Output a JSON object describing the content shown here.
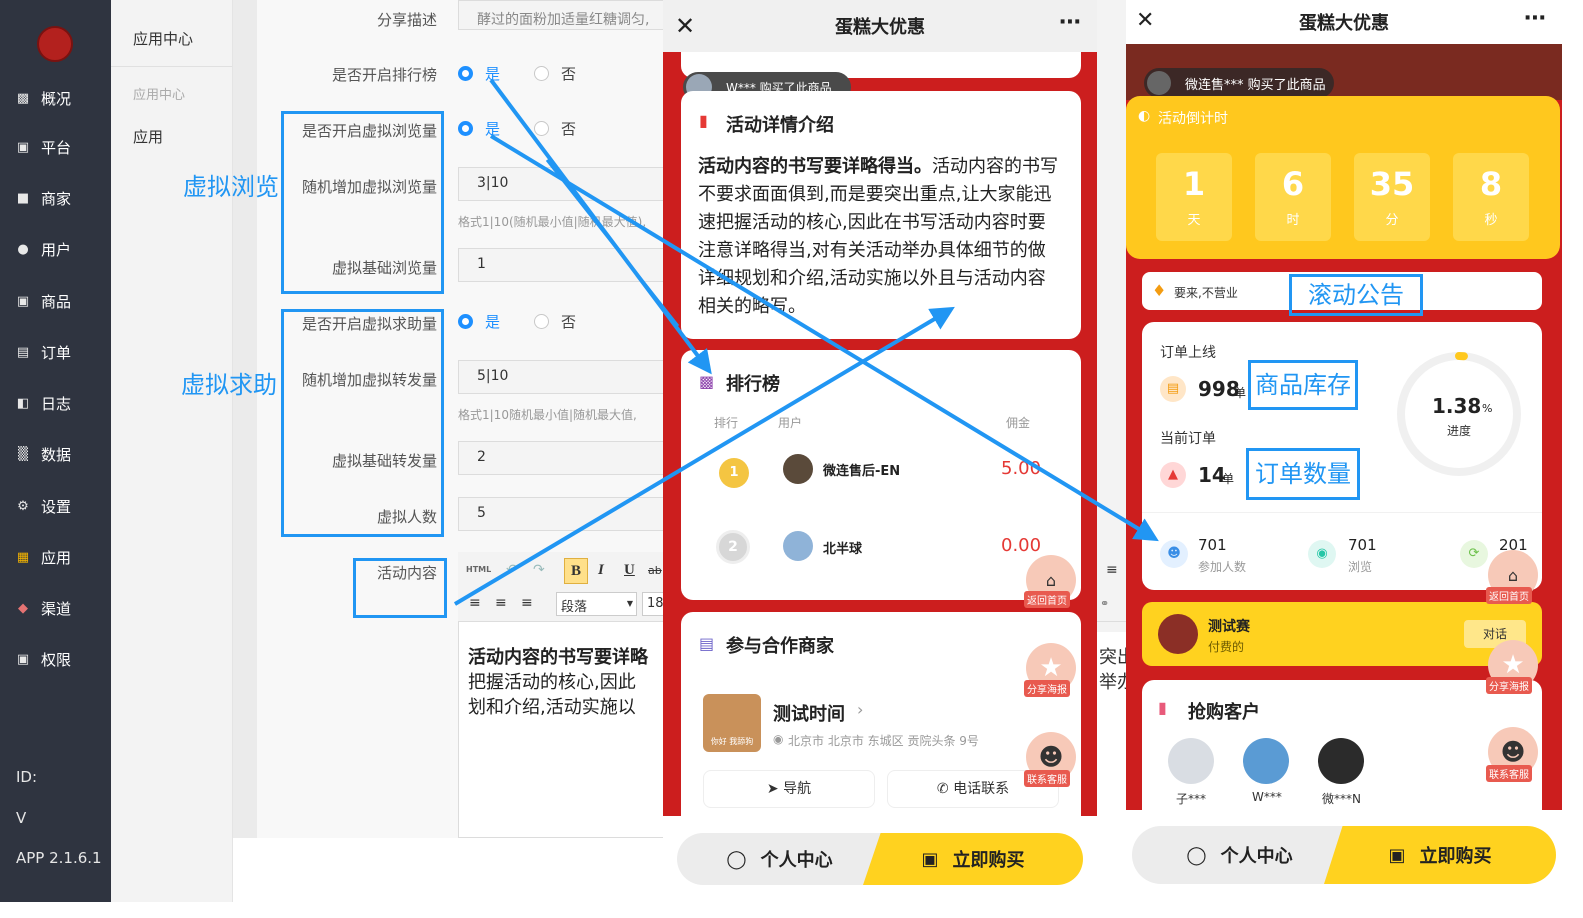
{
  "sidebar": {
    "items": [
      {
        "label": "概况",
        "icon": "chart-icon"
      },
      {
        "label": "平台",
        "icon": "monitor-icon"
      },
      {
        "label": "商家",
        "icon": "store-icon"
      },
      {
        "label": "用户",
        "icon": "user-icon"
      },
      {
        "label": "商品",
        "icon": "goods-icon"
      },
      {
        "label": "订单",
        "icon": "order-icon"
      },
      {
        "label": "日志",
        "icon": "log-icon"
      },
      {
        "label": "数据",
        "icon": "data-icon"
      },
      {
        "label": "设置",
        "icon": "gear-icon"
      },
      {
        "label": "应用",
        "icon": "apps-icon"
      },
      {
        "label": "渠道",
        "icon": "channel-icon"
      },
      {
        "label": "权限",
        "icon": "lock-icon"
      }
    ],
    "footer": {
      "id": "ID:",
      "v": "V",
      "app": "APP 2.1.6.1"
    }
  },
  "submenu": {
    "title": "应用中心",
    "section": "应用中心",
    "item": "应用"
  },
  "form": {
    "share_desc_label": "分享描述",
    "share_desc_value": "酵过的面粉加适量红糖调匀,",
    "rank_label": "是否开启排行榜",
    "virtual_view_label": "是否开启虚拟浏览量",
    "rand_view_label": "随机增加虚拟浏览量",
    "rand_view_value": "3|10",
    "rand_view_hint": "格式1|10(随机最小值|随机最大值),",
    "base_view_label": "虚拟基础浏览量",
    "base_view_value": "1",
    "virtual_help_label": "是否开启虚拟求助量",
    "rand_share_label": "随机增加虚拟转发量",
    "rand_share_value": "5|10",
    "rand_share_hint": "格式1|10随机最小值|随机最大值,",
    "base_share_label": "虚拟基础转发量",
    "base_share_value": "2",
    "virtual_people_label": "虚拟人数",
    "virtual_people_value": "5",
    "content_label": "活动内容",
    "yes": "是",
    "no": "否",
    "editor_html": "HTML",
    "editor_para": "段落",
    "editor_size": "18",
    "editor_text_bold": "活动内容的书写要详略",
    "editor_text_2": "把握活动的核心,因此",
    "editor_text_3": "划和介绍,活动实施以",
    "editor_overflow_1": "突出",
    "editor_overflow_2": "举办"
  },
  "callouts": {
    "virtual_view": "虚拟浏览",
    "virtual_help": "虚拟求助",
    "scroll_notice": "滚动公告",
    "stock": "商品库存",
    "orders": "订单数量"
  },
  "phone1": {
    "title": "蛋糕大优惠",
    "purchase_toast": "W*** 购买了此商品",
    "detail_title": "活动详情介绍",
    "detail_bold": "活动内容的书写要详略得当。",
    "detail_text": "活动内容的书写不要求面面俱到,而是要突出重点,让大家能迅速把握活动的核心,因此在书写活动内容时要注意详略得当,对有关活动举办具体细节的做详细规划和介绍,活动实施以外且与活动内容相关的略写。",
    "rank_title": "排行榜",
    "rank_cols": [
      "排行",
      "用户",
      "佣金"
    ],
    "rank_rows": [
      {
        "badge": "1",
        "user": "微连售后-EN",
        "amount": "5.00"
      },
      {
        "badge": "2",
        "user": "北半球",
        "amount": "0.00"
      }
    ],
    "merchant_title": "参与合作商家",
    "merchant_name": "测试时间",
    "merchant_addr": "北京市 北京市 东城区 贡院头条 9号",
    "merchant_thumb_text": "你好 我舔狗",
    "nav_btn": "导航",
    "call_btn": "电话联系",
    "float_home": "返回首页",
    "float_share": "分享海报",
    "float_service": "联系客服",
    "btn_personal": "个人中心",
    "btn_buy": "立即购买"
  },
  "phone2": {
    "title": "蛋糕大优惠",
    "purchase_toast": "微连售*** 购买了此商品",
    "countdown_title": "活动倒计时",
    "countdown": [
      {
        "n": "1",
        "u": "天"
      },
      {
        "n": "6",
        "u": "时"
      },
      {
        "n": "35",
        "u": "分"
      },
      {
        "n": "8",
        "u": "秒"
      }
    ],
    "notice": "要来,不营业",
    "order_online_label": "订单上线",
    "order_online_value": "998",
    "order_unit": "单",
    "current_order_label": "当前订单",
    "current_order_value": "14",
    "progress_value": "1.38",
    "progress_unit": "%",
    "progress_label": "进度",
    "progress_fraction": 0.0138,
    "stats": [
      {
        "value": "701",
        "label": "参加人数"
      },
      {
        "value": "701",
        "label": "浏览"
      },
      {
        "value": "201",
        "label": ""
      }
    ],
    "contest_title": "测试赛",
    "contest_sub": "付费的",
    "contest_btn": "对话",
    "buyers_title": "抢购客户",
    "buyers": [
      "子***",
      "W***",
      "微***N"
    ],
    "float_home": "返回首页",
    "float_share": "分享海报",
    "float_service": "联系客服",
    "btn_personal": "个人中心",
    "btn_buy": "立即购买"
  },
  "colors": {
    "accent": "#2196f3",
    "brand_red": "#cc1e1e",
    "yellow": "#ffd84a",
    "price_red": "#e53935"
  }
}
